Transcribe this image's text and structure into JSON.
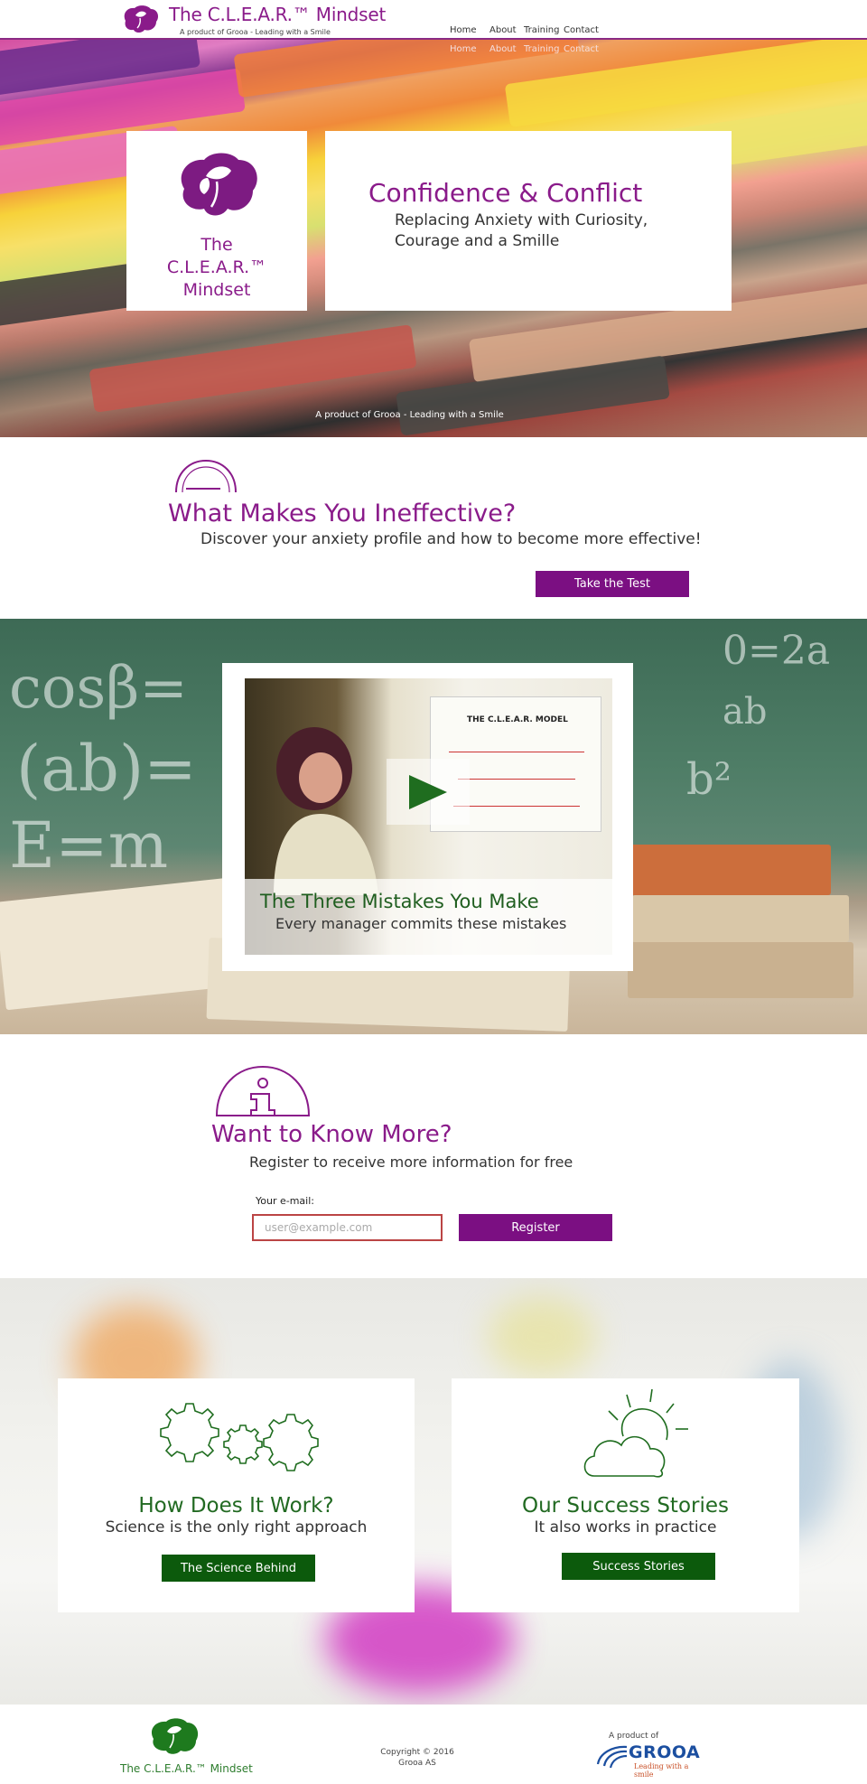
{
  "header": {
    "title": "The C.L.E.A.R.™ Mindset",
    "subtitle": "A product of Grooa - Leading with a Smile",
    "nav": [
      "Home",
      "About",
      "Training",
      "Contact"
    ],
    "nav_repeat": [
      "Home",
      "About",
      "Training",
      "Contact"
    ]
  },
  "hero": {
    "logo_text": [
      "The",
      "C.L.E.A.R.™",
      "Mindset"
    ],
    "title": "Confidence & Conflict",
    "subtitle": "Replacing Anxiety with Curiosity, Courage and a Smille",
    "footer_text": "A product of Grooa - Leading with a Smile"
  },
  "ineffective": {
    "title": "What Makes You Ineffective?",
    "subtitle": "Discover your anxiety profile and how to become more effective!",
    "button": "Take the Test"
  },
  "video": {
    "board_title": "THE C.L.E.A.R. MODEL",
    "title": "The Three Mistakes You Make",
    "subtitle": "Every manager commits these mistakes"
  },
  "know_more": {
    "title": "Want to Know More?",
    "subtitle": "Register to receive more information for free",
    "email_label": "Your e-mail:",
    "email_placeholder": "user@example.com",
    "button": "Register"
  },
  "cards": [
    {
      "title": "How Does It Work?",
      "subtitle": "Science is the only right approach",
      "button": "The Science Behind"
    },
    {
      "title": "Our Success Stories",
      "subtitle": "It also works in practice",
      "button": "Success Stories"
    }
  ],
  "footer": {
    "brand": "The C.L.E.A.R.™ Mindset",
    "copyright_line1": "Copyright © 2016",
    "copyright_line2": "Grooa AS",
    "product_of": "A product of",
    "grooa_name": "GROOA",
    "grooa_tagline": "Leading with a smile"
  },
  "colors": {
    "brand_purple": "#8a1b8a",
    "button_purple": "#7b0f82",
    "brand_green": "#226a22",
    "button_green": "#0c5a0c"
  },
  "icons": [
    "brain-leaf-icon",
    "gauge-icon",
    "play-icon",
    "info-icon",
    "gears-icon",
    "sun-cloud-icon"
  ]
}
